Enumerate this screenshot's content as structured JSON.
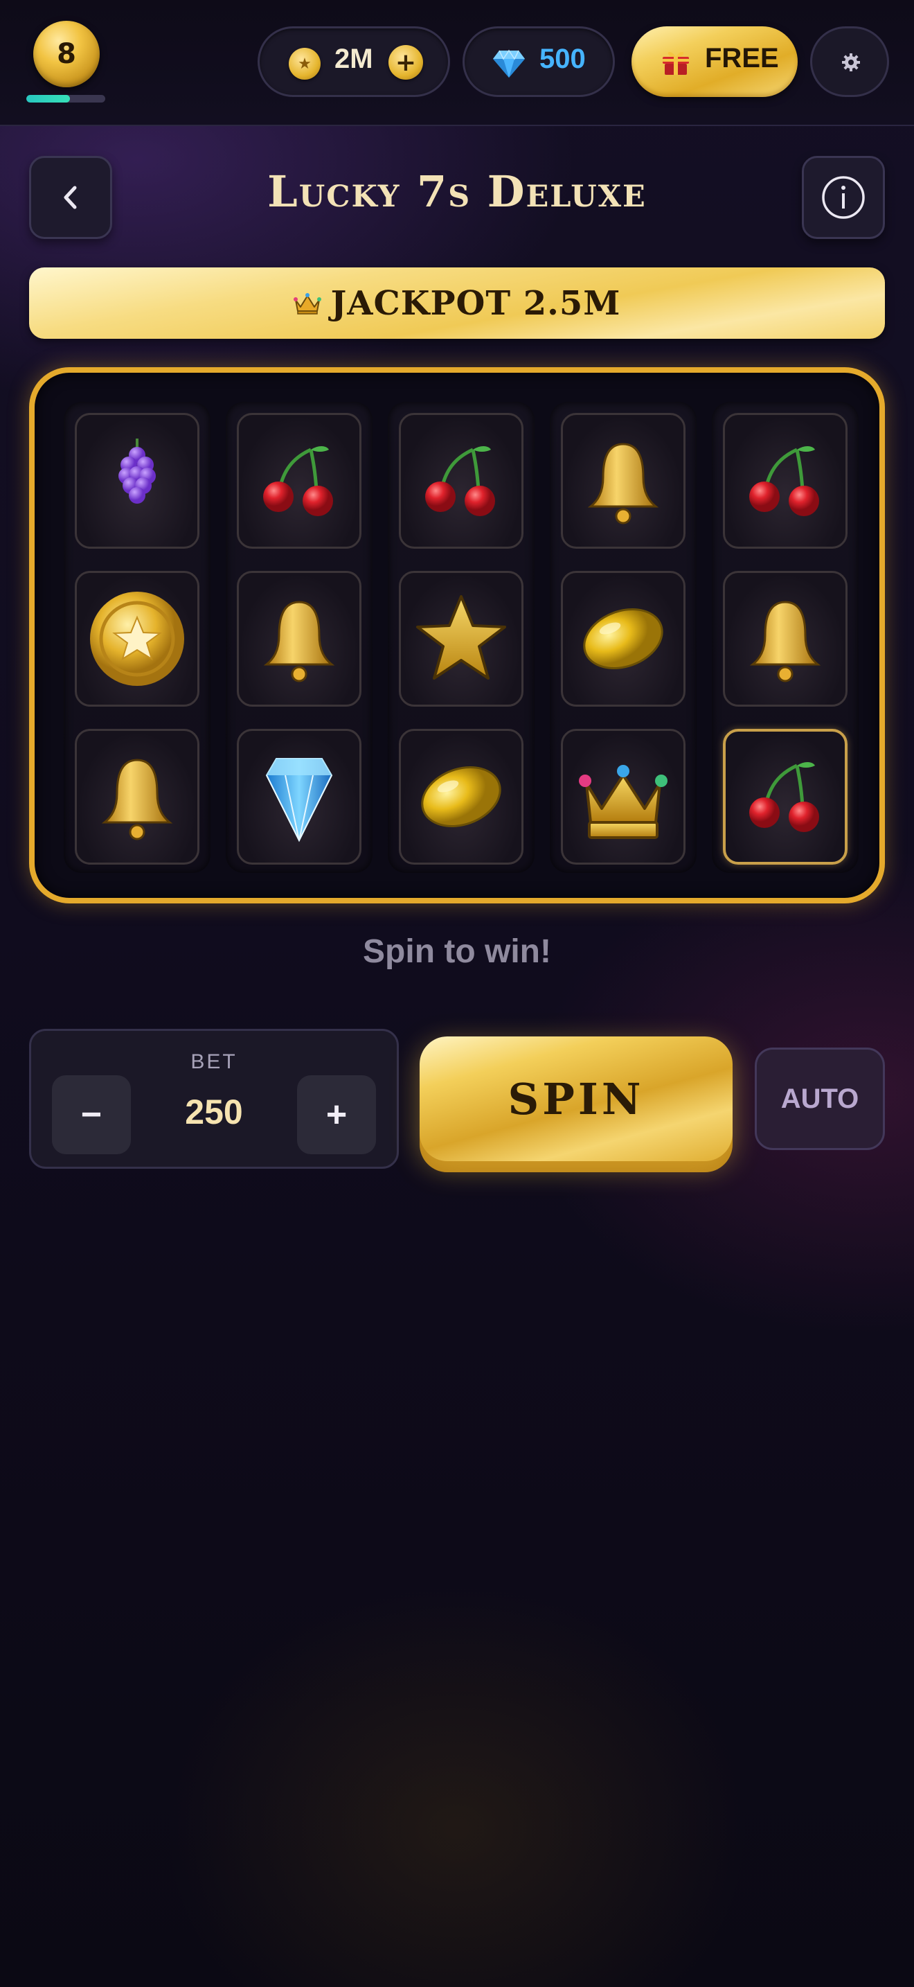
{
  "header": {
    "level": "8",
    "xp_progress": 0.55,
    "coins": "2M",
    "coin_plus": "+",
    "gems": "500",
    "free_label": "FREE"
  },
  "game": {
    "back_icon": "chevron-left-icon",
    "title": "Lucky 7s Deluxe",
    "info_icon": "info-icon",
    "jackpot": "JACKPOT 2.5M",
    "reels": [
      [
        "grapes",
        "coin",
        "bell"
      ],
      [
        "cherries",
        "bell",
        "diamond"
      ],
      [
        "cherries",
        "star",
        "lemon"
      ],
      [
        "bell",
        "lemon",
        "crown"
      ],
      [
        "cherries",
        "bell",
        "cherries"
      ]
    ],
    "highlighted_cell": {
      "reel": 4,
      "row": 3
    },
    "status": "Spin to win!"
  },
  "controls": {
    "bet_label": "BET",
    "bet_value": "250",
    "bet_minus": "−",
    "bet_plus": "+",
    "spin_label": "SPIN",
    "auto_label": "AUTO"
  },
  "colors": {
    "gold": "#e5aa2c",
    "gem_blue": "#46b4ff",
    "xp_teal": "#28c7c0"
  }
}
